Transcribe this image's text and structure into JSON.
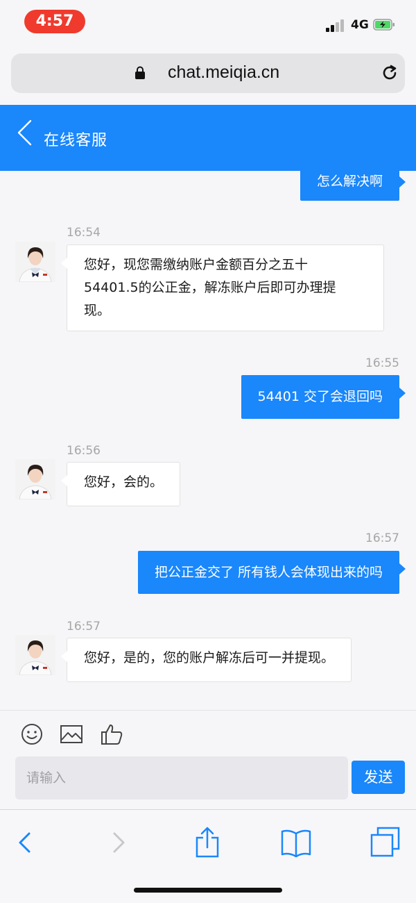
{
  "status_bar": {
    "time": "4:57",
    "network": "4G"
  },
  "browser": {
    "url": "chat.meiqia.cn"
  },
  "header": {
    "title": "在线客服"
  },
  "messages": [
    {
      "from": "me",
      "text": "怎么解决啊"
    },
    {
      "from": "agent",
      "time": "16:54",
      "lines": [
        "您好，现您需缴纳账户金额百分之五十",
        "54401.5的公正金，解冻账户后即可办理提",
        "现。"
      ]
    },
    {
      "from": "me",
      "time": "16:55",
      "text": "54401 交了会退回吗"
    },
    {
      "from": "agent",
      "time": "16:56",
      "text": "您好，会的。"
    },
    {
      "from": "me",
      "time": "16:57",
      "text": "把公正金交了 所有钱人会体现出来的吗"
    },
    {
      "from": "agent",
      "time": "16:57",
      "text": "您好，是的，您的账户解冻后可一并提现。"
    }
  ],
  "composer": {
    "placeholder": "请输入",
    "send_label": "发送"
  },
  "icons": [
    "smiley-icon",
    "image-icon",
    "thumbs-up-icon",
    "back-icon",
    "forward-icon",
    "share-icon",
    "bookmarks-icon",
    "tabs-icon"
  ],
  "colors": {
    "accent": "#1a87fb",
    "time_pill": "#f03a2e",
    "battery_charge": "#4cd964"
  }
}
